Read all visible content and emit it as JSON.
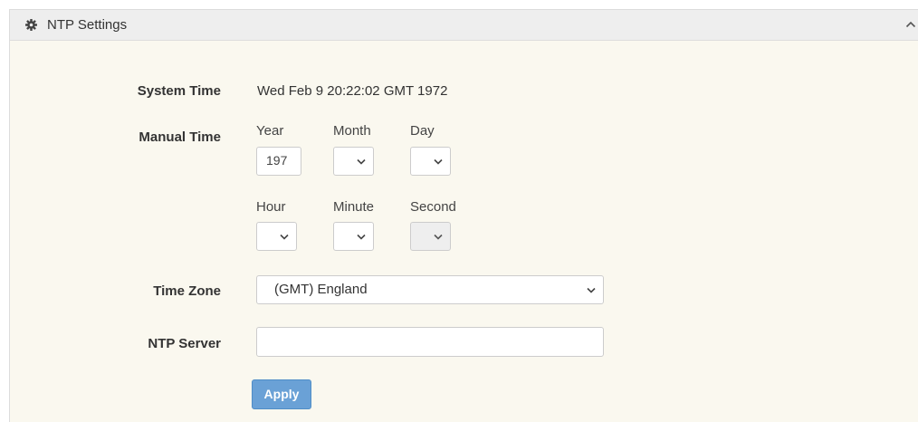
{
  "panel": {
    "title": "NTP Settings",
    "icon": "gear-icon",
    "collapse_icon": "chevron-up-icon"
  },
  "system_time": {
    "label": "System Time",
    "value": "Wed Feb 9 20:22:02 GMT 1972"
  },
  "manual_time": {
    "label": "Manual Time",
    "year": {
      "label": "Year",
      "value": "197"
    },
    "month": {
      "label": "Month",
      "value": ""
    },
    "day": {
      "label": "Day",
      "value": ""
    },
    "hour": {
      "label": "Hour",
      "value": ""
    },
    "minute": {
      "label": "Minute",
      "value": ""
    },
    "second": {
      "label": "Second",
      "value": "",
      "disabled": true
    }
  },
  "time_zone": {
    "label": "Time Zone",
    "value": "(GMT) England"
  },
  "ntp_server": {
    "label": "NTP Server",
    "value": ""
  },
  "apply_label": "Apply",
  "colors": {
    "panel_bg": "#faf8ef",
    "header_bg": "#eeeeee",
    "button_bg": "#6aa1d6"
  }
}
